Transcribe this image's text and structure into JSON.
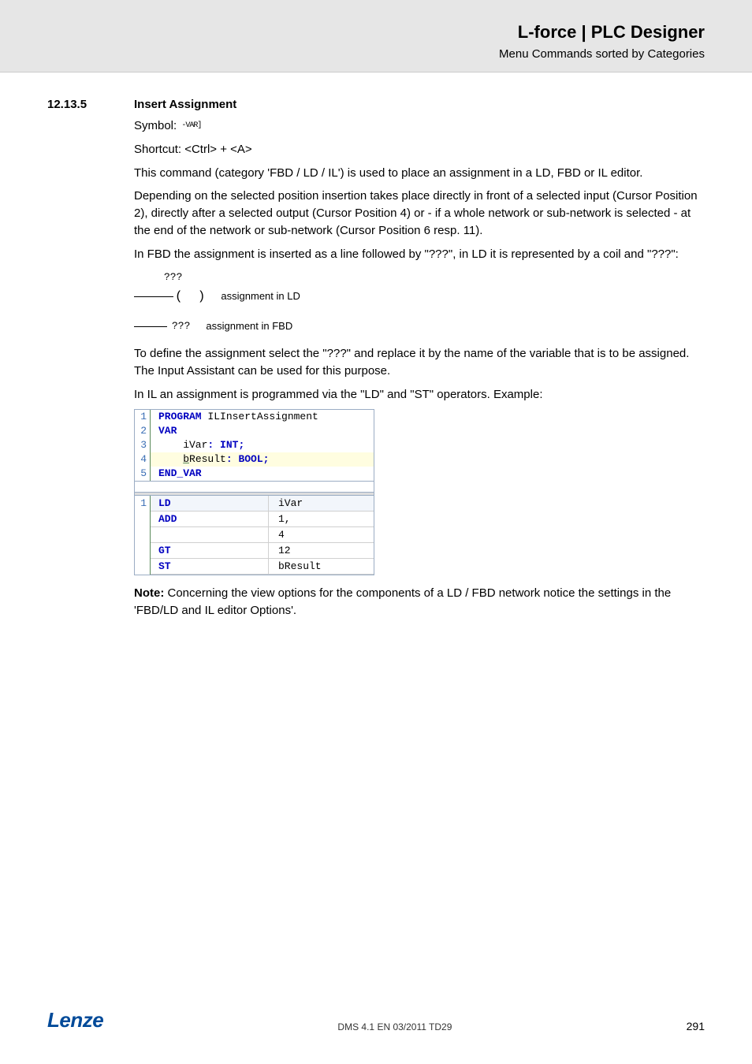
{
  "header": {
    "title": "L-force | PLC Designer",
    "subtitle": "Menu Commands sorted by Categories"
  },
  "section": {
    "number": "12.13.5",
    "title": "Insert Assignment"
  },
  "body": {
    "symbol_label": "Symbol:",
    "symbol_icon_text": "-VAR]",
    "shortcut": "Shortcut:  <Ctrl> + <A>",
    "p1": "This command (category 'FBD / LD / IL') is used to place an assignment in a LD, FBD or IL editor.",
    "p2": "Depending on the selected position insertion takes place directly in front of a selected input (Cursor Position 2), directly after a selected output (Cursor Position 4) or - if a whole network or sub-network is selected - at the end of the network or sub-network (Cursor Position 6 resp. 11).",
    "p3": "In FBD the assignment is inserted as a line followed by \"???\", in LD it is represented by a coil and \"???\":",
    "ld_qqq": "???",
    "ld_label": "assignment in LD",
    "fbd_qqq": "???",
    "fbd_label": "assignment in FBD",
    "p4": "To define the assignment select the \"???\" and replace it by the name of the variable that is to be assigned. The Input Assistant can be used for this purpose.",
    "p5": "In IL an assignment is programmed via the \"LD\" and \"ST\" operators. Example:"
  },
  "code_decl": {
    "lines": [
      {
        "n": "1",
        "kw": "PROGRAM",
        "rest": " ILInsertAssignment",
        "hl": false,
        "text": ""
      },
      {
        "n": "2",
        "kw": "VAR",
        "rest": "",
        "hl": false,
        "text": ""
      },
      {
        "n": "3",
        "kw": "",
        "rest": "",
        "hl": false,
        "text_pre": "    iVar",
        "colon": ": ",
        "type": "INT",
        "semi": ";"
      },
      {
        "n": "4",
        "kw": "",
        "rest": "",
        "hl": true,
        "text_pre_u": "    b",
        "text_pre": "Result",
        "colon": ": ",
        "type": "BOOL",
        "semi": ";"
      },
      {
        "n": "5",
        "kw": "END_VAR",
        "rest": "",
        "hl": false,
        "text": ""
      }
    ]
  },
  "code_il": {
    "rows": [
      {
        "n": "1",
        "op": "LD",
        "arg": "iVar",
        "first": true
      },
      {
        "n": "",
        "op": "ADD",
        "arg": "1,",
        "first": false
      },
      {
        "n": "",
        "op": "",
        "arg": "4",
        "first": false
      },
      {
        "n": "",
        "op": "GT",
        "arg": "12",
        "first": false
      },
      {
        "n": "",
        "op": "ST",
        "arg": "bResult",
        "first": false
      }
    ]
  },
  "note": {
    "label": "Note:",
    "text": " Concerning the view options for the components of a LD / FBD network notice the settings in the 'FBD/LD and IL editor Options'."
  },
  "footer": {
    "logo": "Lenze",
    "center": "DMS 4.1 EN 03/2011 TD29",
    "page": "291"
  }
}
